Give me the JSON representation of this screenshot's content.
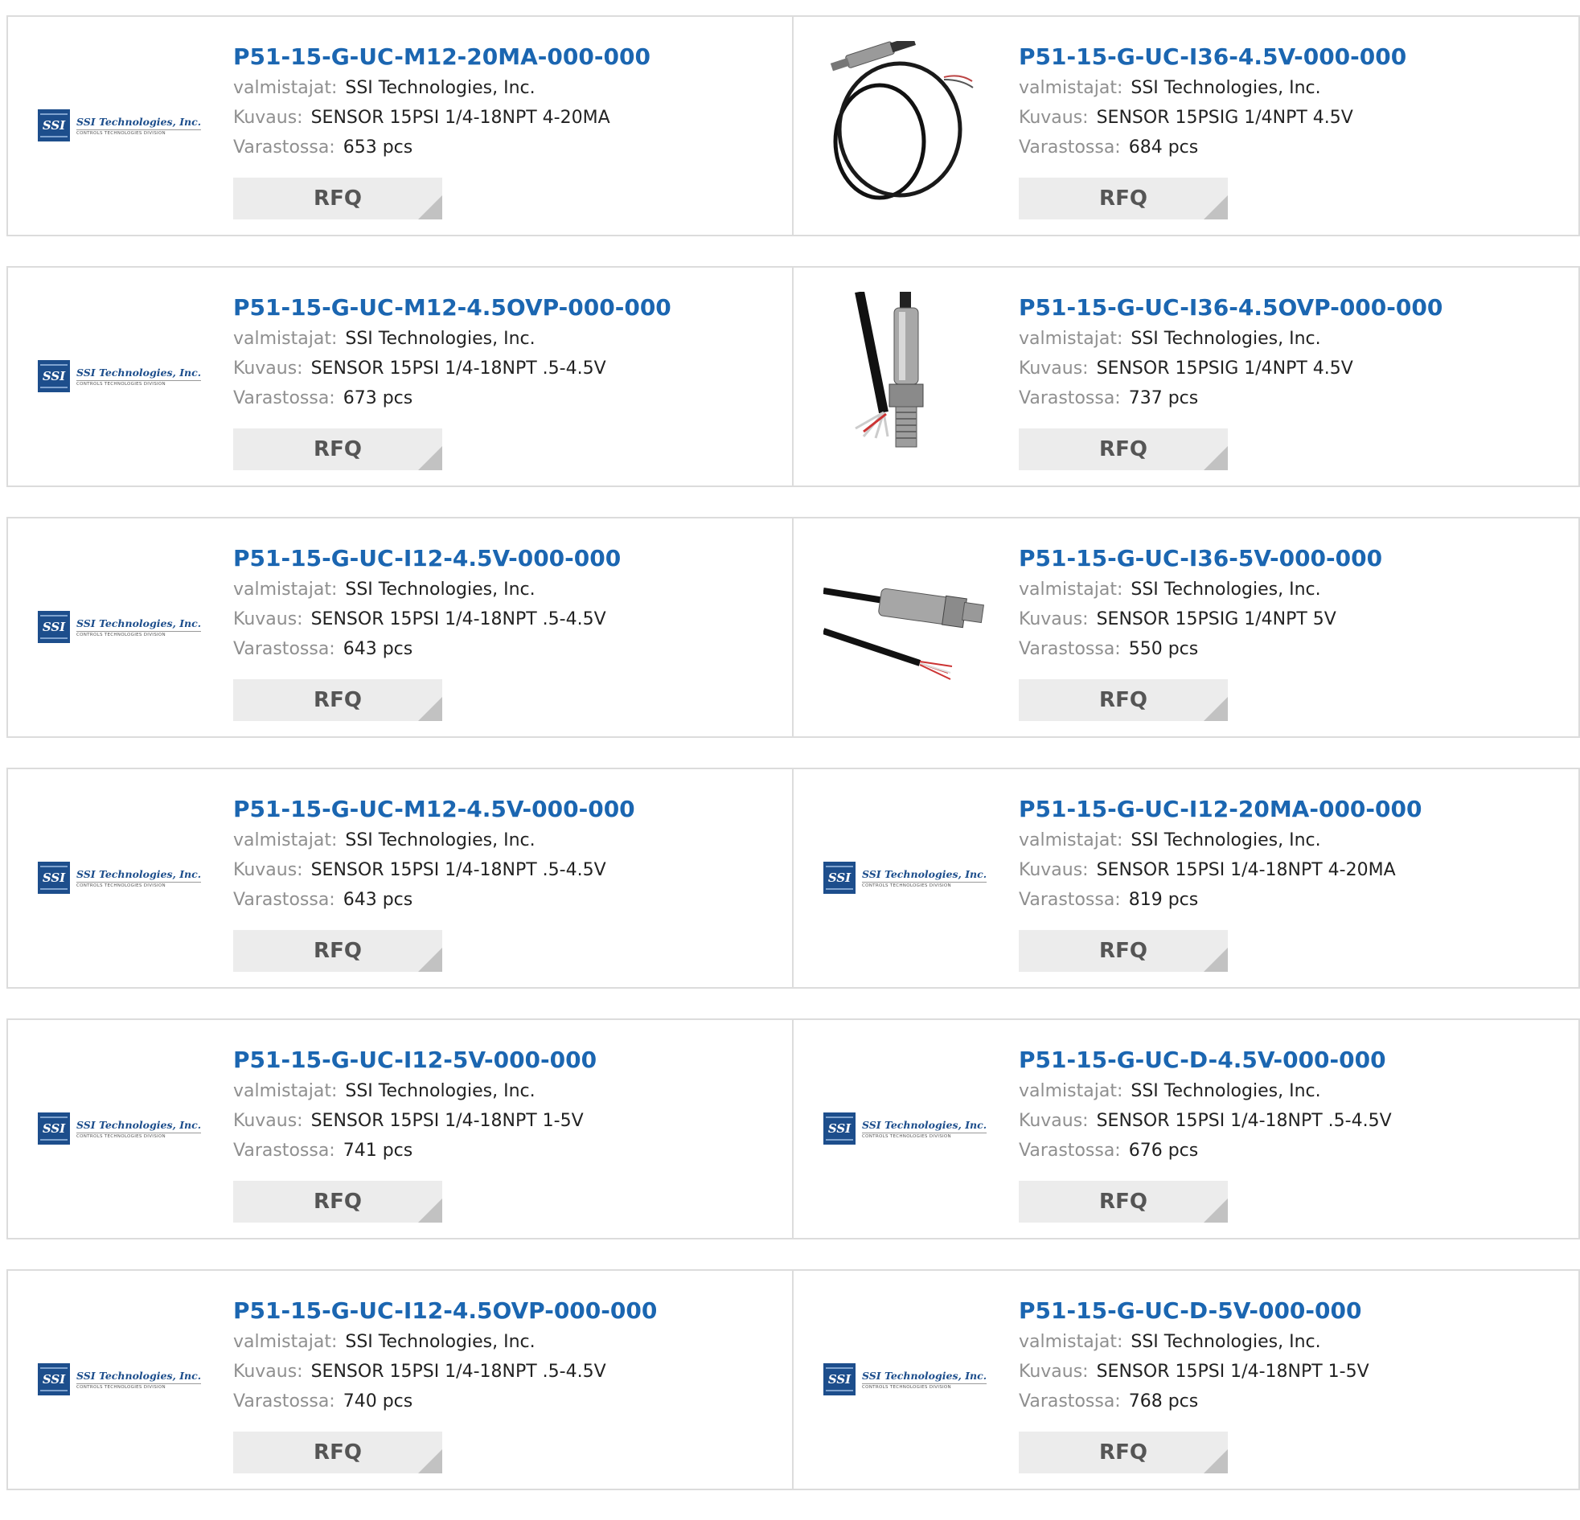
{
  "labels": {
    "manufacturer": "valmistajat:",
    "description": "Kuvaus:",
    "stock": "Varastossa:",
    "rfq": "RFQ"
  },
  "logo": {
    "box_text": "SSI",
    "name": "SSI Technologies, Inc.",
    "subtitle": "CONTROLS TECHNOLOGIES DIVISION"
  },
  "products": [
    {
      "title": "P51-15-G-UC-M12-20MA-000-000",
      "manufacturer": "SSI Technologies, Inc.",
      "description": "SENSOR 15PSI 1/4-18NPT 4-20MA",
      "stock": "653 pcs",
      "image": "logo"
    },
    {
      "title": "P51-15-G-UC-I36-4.5V-000-000",
      "manufacturer": "SSI Technologies, Inc.",
      "description": "SENSOR 15PSIG 1/4NPT 4.5V",
      "stock": "684 pcs",
      "image": "sensor-coiled-cable"
    },
    {
      "title": "P51-15-G-UC-M12-4.5OVP-000-000",
      "manufacturer": "SSI Technologies, Inc.",
      "description": "SENSOR 15PSI 1/4-18NPT .5-4.5V",
      "stock": "673 pcs",
      "image": "logo"
    },
    {
      "title": "P51-15-G-UC-I36-4.5OVP-000-000",
      "manufacturer": "SSI Technologies, Inc.",
      "description": "SENSOR 15PSIG 1/4NPT 4.5V",
      "stock": "737 pcs",
      "image": "sensor-vertical"
    },
    {
      "title": "P51-15-G-UC-I12-4.5V-000-000",
      "manufacturer": "SSI Technologies, Inc.",
      "description": "SENSOR 15PSI 1/4-18NPT .5-4.5V",
      "stock": "643 pcs",
      "image": "logo"
    },
    {
      "title": "P51-15-G-UC-I36-5V-000-000",
      "manufacturer": "SSI Technologies, Inc.",
      "description": "SENSOR 15PSIG 1/4NPT 5V",
      "stock": "550 pcs",
      "image": "sensor-horizontal"
    },
    {
      "title": "P51-15-G-UC-M12-4.5V-000-000",
      "manufacturer": "SSI Technologies, Inc.",
      "description": "SENSOR 15PSI 1/4-18NPT .5-4.5V",
      "stock": "643 pcs",
      "image": "logo"
    },
    {
      "title": "P51-15-G-UC-I12-20MA-000-000",
      "manufacturer": "SSI Technologies, Inc.",
      "description": "SENSOR 15PSI 1/4-18NPT 4-20MA",
      "stock": "819 pcs",
      "image": "logo"
    },
    {
      "title": "P51-15-G-UC-I12-5V-000-000",
      "manufacturer": "SSI Technologies, Inc.",
      "description": "SENSOR 15PSI 1/4-18NPT 1-5V",
      "stock": "741 pcs",
      "image": "logo"
    },
    {
      "title": "P51-15-G-UC-D-4.5V-000-000",
      "manufacturer": "SSI Technologies, Inc.",
      "description": "SENSOR 15PSI 1/4-18NPT .5-4.5V",
      "stock": "676 pcs",
      "image": "logo"
    },
    {
      "title": "P51-15-G-UC-I12-4.5OVP-000-000",
      "manufacturer": "SSI Technologies, Inc.",
      "description": "SENSOR 15PSI 1/4-18NPT .5-4.5V",
      "stock": "740 pcs",
      "image": "logo"
    },
    {
      "title": "P51-15-G-UC-D-5V-000-000",
      "manufacturer": "SSI Technologies, Inc.",
      "description": "SENSOR 15PSI 1/4-18NPT 1-5V",
      "stock": "768 pcs",
      "image": "logo"
    }
  ]
}
